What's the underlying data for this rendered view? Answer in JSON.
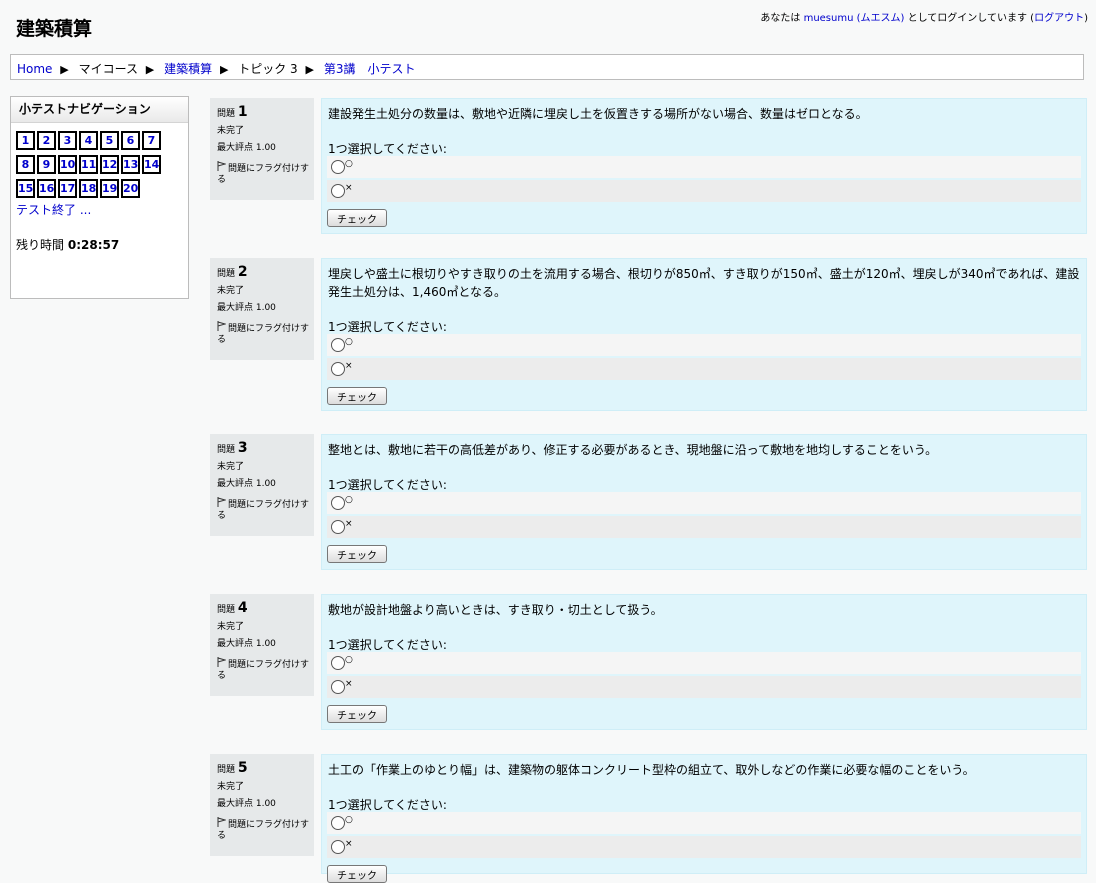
{
  "header": {
    "site_title": "建築積算",
    "login_prefix": "あなたは ",
    "user_name": "muesumu (ムエスム)",
    "login_middle": " としてログインしています (",
    "logout_label": "ログアウト",
    "login_suffix": ")"
  },
  "breadcrumb": {
    "home": "Home",
    "my_courses": "マイコース",
    "course": "建築積算",
    "topic": "トピック 3",
    "quiz": "第3講　小テスト",
    "separator": "▶"
  },
  "quiz_nav": {
    "title": "小テストナビゲーション",
    "buttons": [
      "1",
      "2",
      "3",
      "4",
      "5",
      "6",
      "7",
      "8",
      "9",
      "10",
      "11",
      "12",
      "13",
      "14",
      "15",
      "16",
      "17",
      "18",
      "19",
      "20"
    ],
    "finish_label": "テスト終了 ...",
    "timer_label": "残り時間",
    "timer_value": "0:28:57"
  },
  "questions": [
    {
      "label": "問題",
      "number": "1",
      "state": "未完了",
      "grade": "最大評点 1.00",
      "flag": "問題にフラグ付けする",
      "text": "建設発生土処分の数量は、敷地や近隣に埋戻し土を仮置きする場所がない場合、数量はゼロとなる。",
      "prompt": "1つ選択してください:",
      "options": [
        "○",
        "×"
      ],
      "check_label": "チェック"
    },
    {
      "label": "問題",
      "number": "2",
      "state": "未完了",
      "grade": "最大評点 1.00",
      "flag": "問題にフラグ付けする",
      "text": "埋戻しや盛土に根切りやすき取りの土を流用する場合、根切りが850㎥、すき取りが150㎥、盛土が120㎥、埋戻しが340㎥であれば、建設発生土処分は、1,460㎥となる。",
      "prompt": "1つ選択してください:",
      "options": [
        "○",
        "×"
      ],
      "check_label": "チェック"
    },
    {
      "label": "問題",
      "number": "3",
      "state": "未完了",
      "grade": "最大評点 1.00",
      "flag": "問題にフラグ付けする",
      "text": "整地とは、敷地に若干の高低差があり、修正する必要があるとき、現地盤に沿って敷地を地均しすることをいう。",
      "prompt": "1つ選択してください:",
      "options": [
        "○",
        "×"
      ],
      "check_label": "チェック"
    },
    {
      "label": "問題",
      "number": "4",
      "state": "未完了",
      "grade": "最大評点 1.00",
      "flag": "問題にフラグ付けする",
      "text": "敷地が設計地盤より高いときは、すき取り・切土として扱う。",
      "prompt": "1つ選択してください:",
      "options": [
        "○",
        "×"
      ],
      "check_label": "チェック"
    },
    {
      "label": "問題",
      "number": "5",
      "state": "未完了",
      "grade": "最大評点 1.00",
      "flag": "問題にフラグ付けする",
      "text": "土工の「作業上のゆとり幅」は、建築物の躯体コンクリート型枠の組立て、取外しなどの作業に必要な幅のことをいう。",
      "prompt": "1つ選択してください:",
      "options": [
        "○",
        "×"
      ],
      "check_label": "チェック"
    }
  ]
}
